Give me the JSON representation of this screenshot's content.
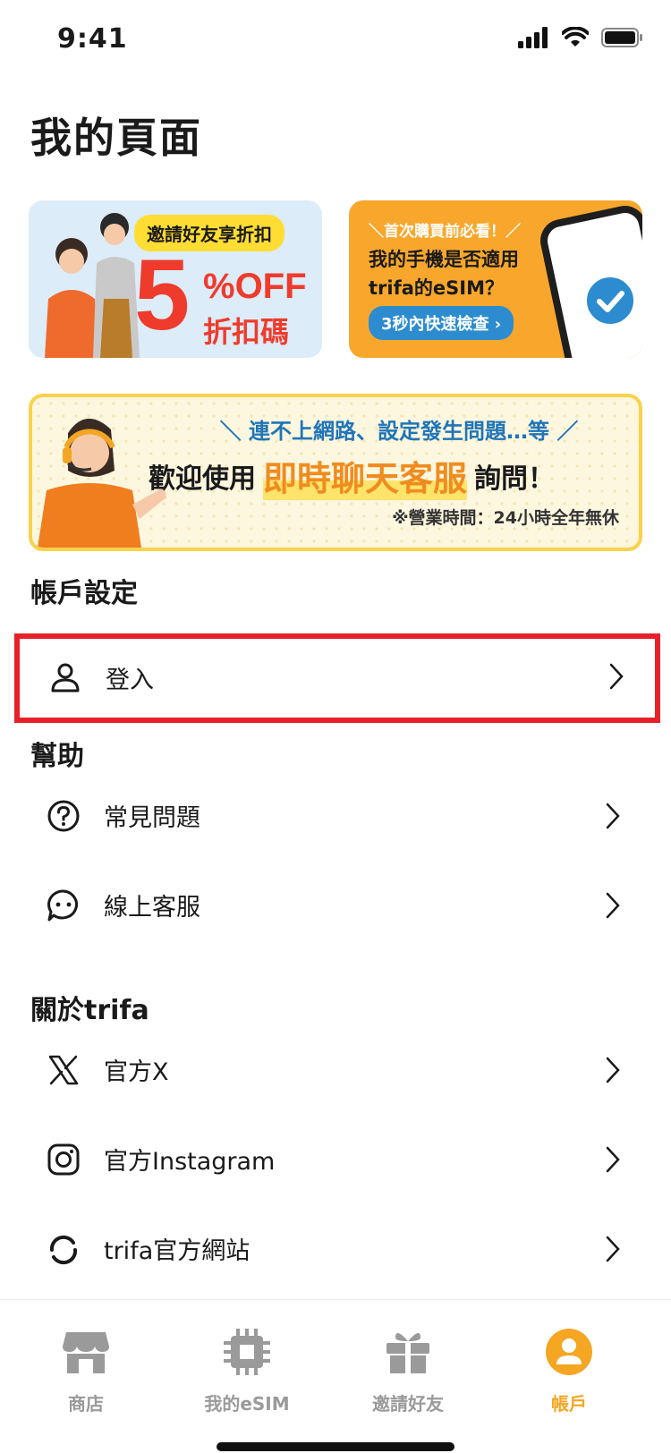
{
  "status_bar": {
    "time": "9:41"
  },
  "page_title": "我的頁面",
  "banners": {
    "invite": {
      "pill": "邀請好友享折扣",
      "big_number": "5",
      "off": "%OFF",
      "code": "折扣碼"
    },
    "check": {
      "line1": "＼首次購買前必看！／",
      "line2": "我的手機是否適用",
      "line3": "trifa的eSIM？",
      "button": "3秒內快速檢查 ›"
    },
    "chat": {
      "top": "＼ 連不上網路、設定發生問題…等 ／",
      "mid_before": "歡迎使用",
      "mid_highlight": "即時聊天客服",
      "mid_after": "詢問！",
      "hours": "※營業時間：24小時全年無休"
    }
  },
  "account_section": {
    "title": "帳戶設定",
    "items": [
      {
        "label": "登入",
        "icon": "user-icon"
      }
    ]
  },
  "help_section": {
    "title": "幫助",
    "items": [
      {
        "label": "常見問題",
        "icon": "question-circle-icon"
      },
      {
        "label": "線上客服",
        "icon": "chat-bubble-icon"
      }
    ]
  },
  "about_section": {
    "title": "關於trifa",
    "items": [
      {
        "label": "官方X",
        "icon": "x-logo-icon"
      },
      {
        "label": "官方Instagram",
        "icon": "instagram-icon"
      },
      {
        "label": "trifa官方網站",
        "icon": "trifa-logo-icon"
      }
    ]
  },
  "tab_bar": {
    "tabs": [
      {
        "label": "商店",
        "icon": "store-icon",
        "active": false
      },
      {
        "label": "我的eSIM",
        "icon": "esim-chip-icon",
        "active": false
      },
      {
        "label": "邀請好友",
        "icon": "gift-icon",
        "active": false
      },
      {
        "label": "帳戶",
        "icon": "account-circle-icon",
        "active": true
      }
    ]
  },
  "colors": {
    "accent": "#f5a623",
    "highlight_border": "#e8202a",
    "inactive_tab": "#9a9a9a",
    "link_blue": "#2d8ccf"
  }
}
